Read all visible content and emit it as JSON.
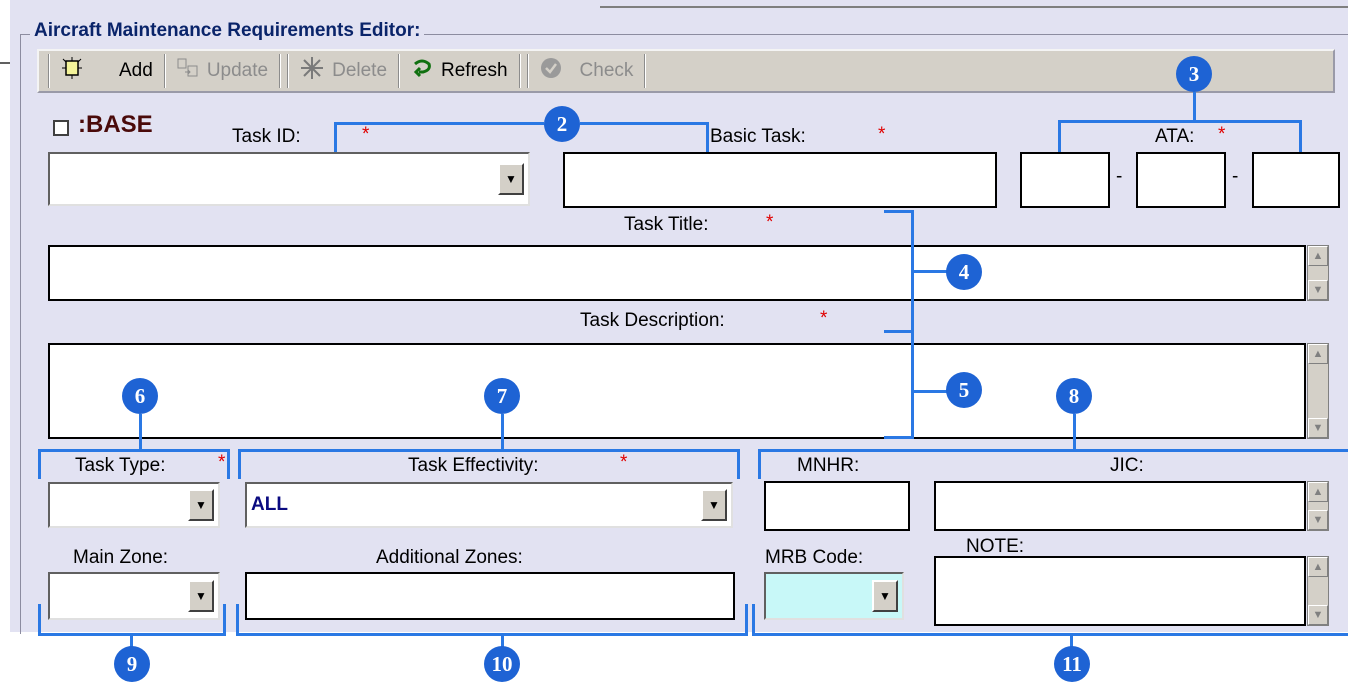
{
  "editor": {
    "title": "Aircraft Maintenance Requirements Editor:"
  },
  "toolbar": {
    "add": "Add",
    "update": "Update",
    "delete": "Delete",
    "refresh": "Refresh",
    "check": "Check"
  },
  "base": {
    "label": ":BASE",
    "checked": false
  },
  "fields": {
    "task_id": "Task ID:",
    "basic_task": "Basic Task:",
    "ata": "ATA:",
    "ata_sep": "-",
    "task_title": "Task Title:",
    "task_description": "Task Description:",
    "task_type": "Task Type:",
    "task_effectivity": "Task Effectivity:",
    "task_effectivity_value": "ALL",
    "mnhr": "MNHR:",
    "jic": "JIC:",
    "main_zone": "Main Zone:",
    "additional_zones": "Additional Zones:",
    "mrb_code": "MRB Code:",
    "note": "NOTE:",
    "required_mark": "*"
  },
  "callouts": [
    "2",
    "3",
    "4",
    "5",
    "6",
    "7",
    "8",
    "9",
    "10",
    "11"
  ],
  "colors": {
    "callout": "#1e63d4",
    "bracket": "#2a78e4",
    "required": "#e00000",
    "panel": "#e2e2f2",
    "mrb": "#c8f8f8"
  }
}
